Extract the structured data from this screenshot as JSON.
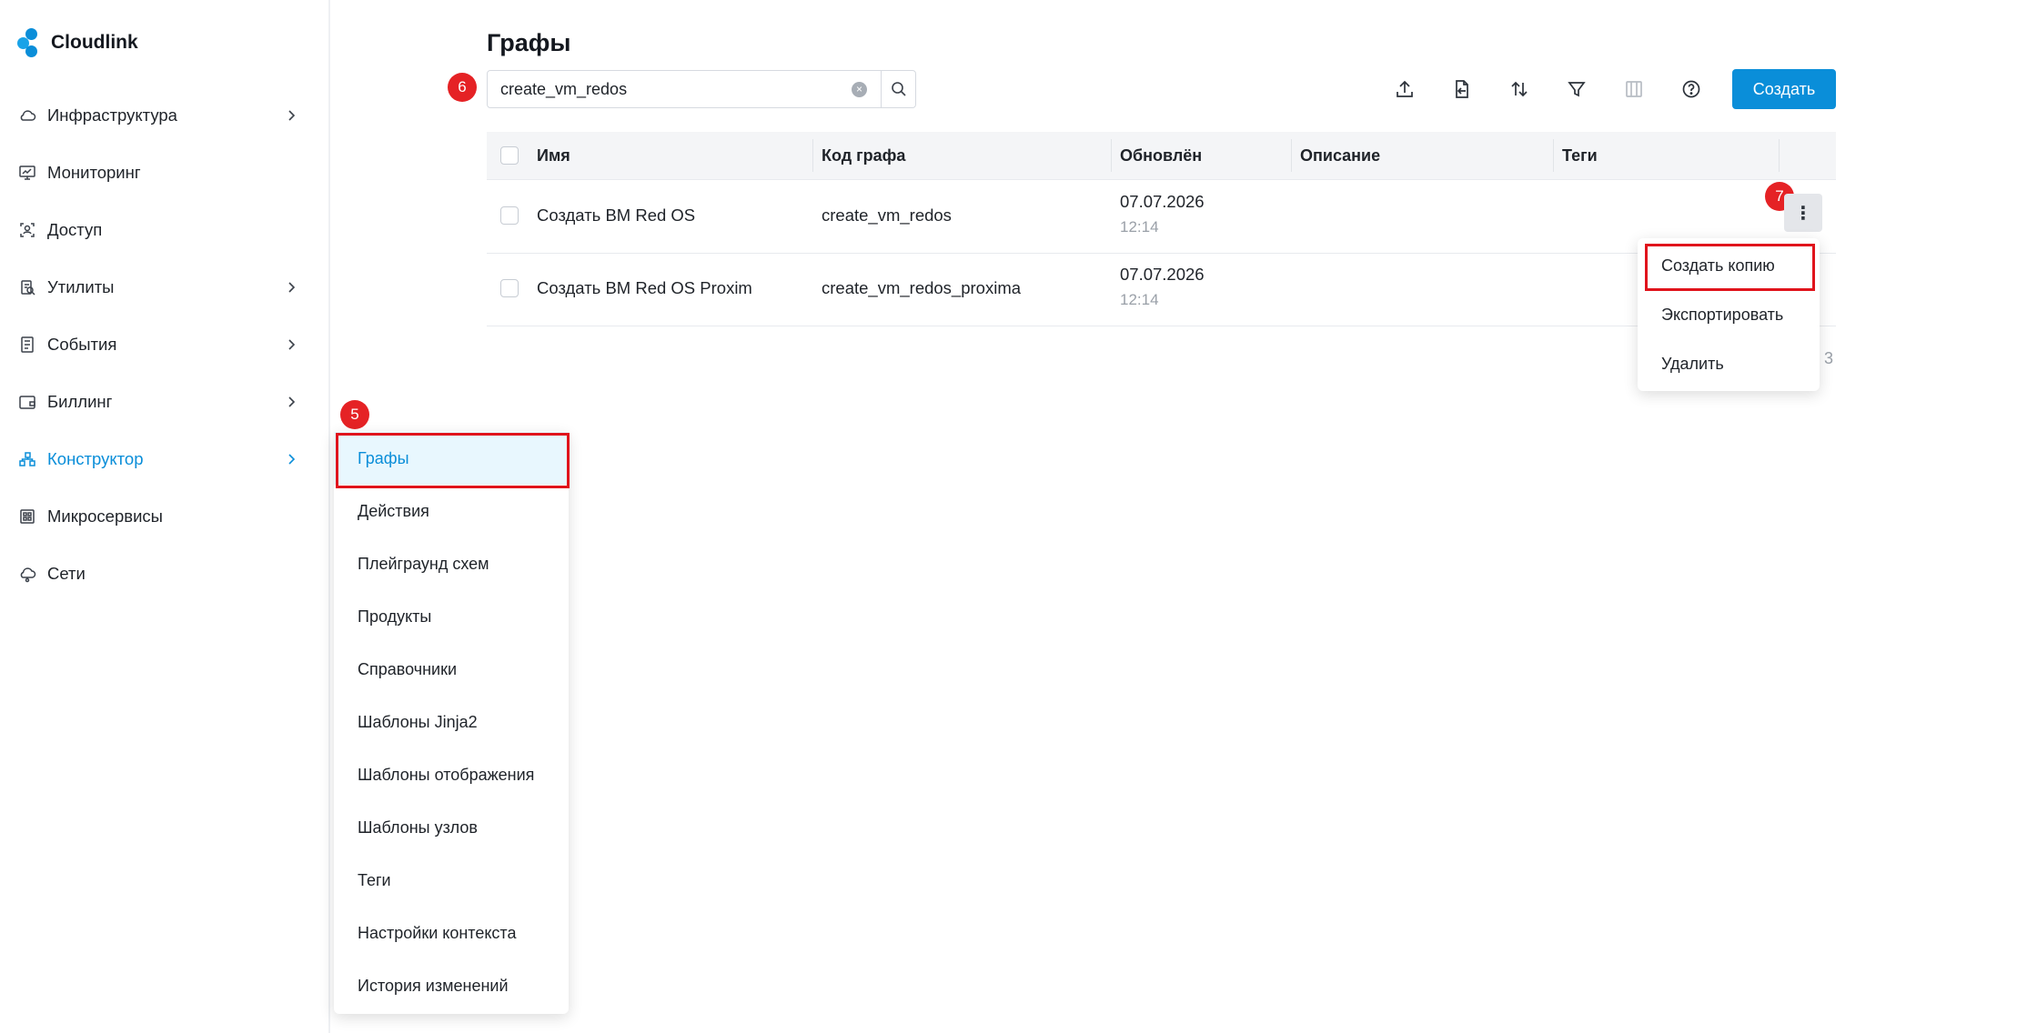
{
  "app": {
    "brand": "Cloudlink",
    "accent_color": "#0a8ed9",
    "highlight_color": "#e0141c"
  },
  "sidebar": {
    "items": [
      {
        "label": "Инфраструктура",
        "icon": "cloud-icon",
        "has_submenu": true
      },
      {
        "label": "Мониторинг",
        "icon": "monitor-icon",
        "has_submenu": false
      },
      {
        "label": "Доступ",
        "icon": "access-icon",
        "has_submenu": false
      },
      {
        "label": "Утилиты",
        "icon": "utilities-icon",
        "has_submenu": true
      },
      {
        "label": "События",
        "icon": "events-icon",
        "has_submenu": true
      },
      {
        "label": "Биллинг",
        "icon": "wallet-icon",
        "has_submenu": true
      },
      {
        "label": "Конструктор",
        "icon": "constructor-icon",
        "has_submenu": true,
        "active": true
      },
      {
        "label": "Микросервисы",
        "icon": "microservices-icon",
        "has_submenu": false
      },
      {
        "label": "Сети",
        "icon": "network-icon",
        "has_submenu": false
      }
    ]
  },
  "submenu": {
    "items": [
      {
        "label": "Графы",
        "active": true
      },
      {
        "label": "Действия"
      },
      {
        "label": "Плейграунд схем"
      },
      {
        "label": "Продукты"
      },
      {
        "label": "Справочники"
      },
      {
        "label": "Шаблоны Jinja2"
      },
      {
        "label": "Шаблоны отображения"
      },
      {
        "label": "Шаблоны узлов"
      },
      {
        "label": "Теги"
      },
      {
        "label": "Настройки контекста"
      },
      {
        "label": "История изменений"
      }
    ]
  },
  "main": {
    "title": "Графы",
    "search": {
      "value": "create_vm_redos",
      "clear_symbol": "×"
    },
    "create_label": "Создать",
    "toolbar_icons": [
      "upload-icon",
      "import-file-icon",
      "sort-icon",
      "filter-icon",
      "column-settings-icon",
      "help-icon"
    ]
  },
  "table": {
    "columns": [
      "Имя",
      "Код графа",
      "Обновлён",
      "Описание",
      "Теги"
    ],
    "rows": [
      {
        "name": "Создать ВМ Red OS",
        "code": "create_vm_redos",
        "date": "07.07.2026",
        "time": "12:14",
        "description": "",
        "tags": ""
      },
      {
        "name": "Создать ВМ Red OS Proxim",
        "code": "create_vm_redos_proxima",
        "date": "07.07.2026",
        "time": "12:14",
        "description": "",
        "tags": ""
      }
    ],
    "kebab_symbol": "⋮",
    "pager_fragment": "3"
  },
  "row_menu": {
    "items": [
      "Создать копию",
      "Экспортировать",
      "Удалить"
    ]
  },
  "steps": {
    "five": "5",
    "six": "6",
    "seven": "7"
  }
}
